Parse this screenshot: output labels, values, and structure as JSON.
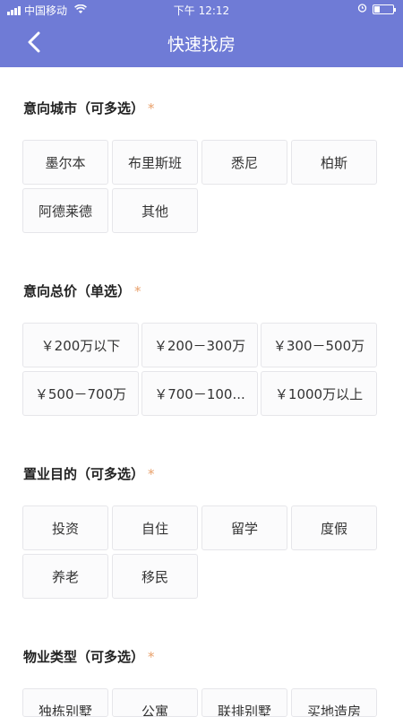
{
  "status_bar": {
    "carrier": "中国移动",
    "time": "下午 12:12"
  },
  "nav": {
    "title": "快速找房",
    "back_icon": "chevron-left-icon"
  },
  "colors": {
    "header": "#6f7bd6",
    "required_star": "#e8a06b"
  },
  "sections": {
    "city": {
      "title": "意向城市（可多选）",
      "required_mark": "*",
      "options": [
        "墨尔本",
        "布里斯班",
        "悉尼",
        "柏斯",
        "阿德莱德",
        "其他"
      ]
    },
    "price": {
      "title": "意向总价（单选）",
      "required_mark": "*",
      "options": [
        "￥200万以下",
        "￥200－300万",
        "￥300－500万",
        "￥500－700万",
        "￥700－100...",
        "￥1000万以上"
      ]
    },
    "purpose": {
      "title": "置业目的（可多选）",
      "required_mark": "*",
      "options": [
        "投资",
        "自住",
        "留学",
        "度假",
        "养老",
        "移民"
      ]
    },
    "property_type": {
      "title": "物业类型（可多选）",
      "required_mark": "*",
      "options": [
        "独栋别墅",
        "公寓",
        "联排别墅",
        "买地造房"
      ]
    }
  }
}
